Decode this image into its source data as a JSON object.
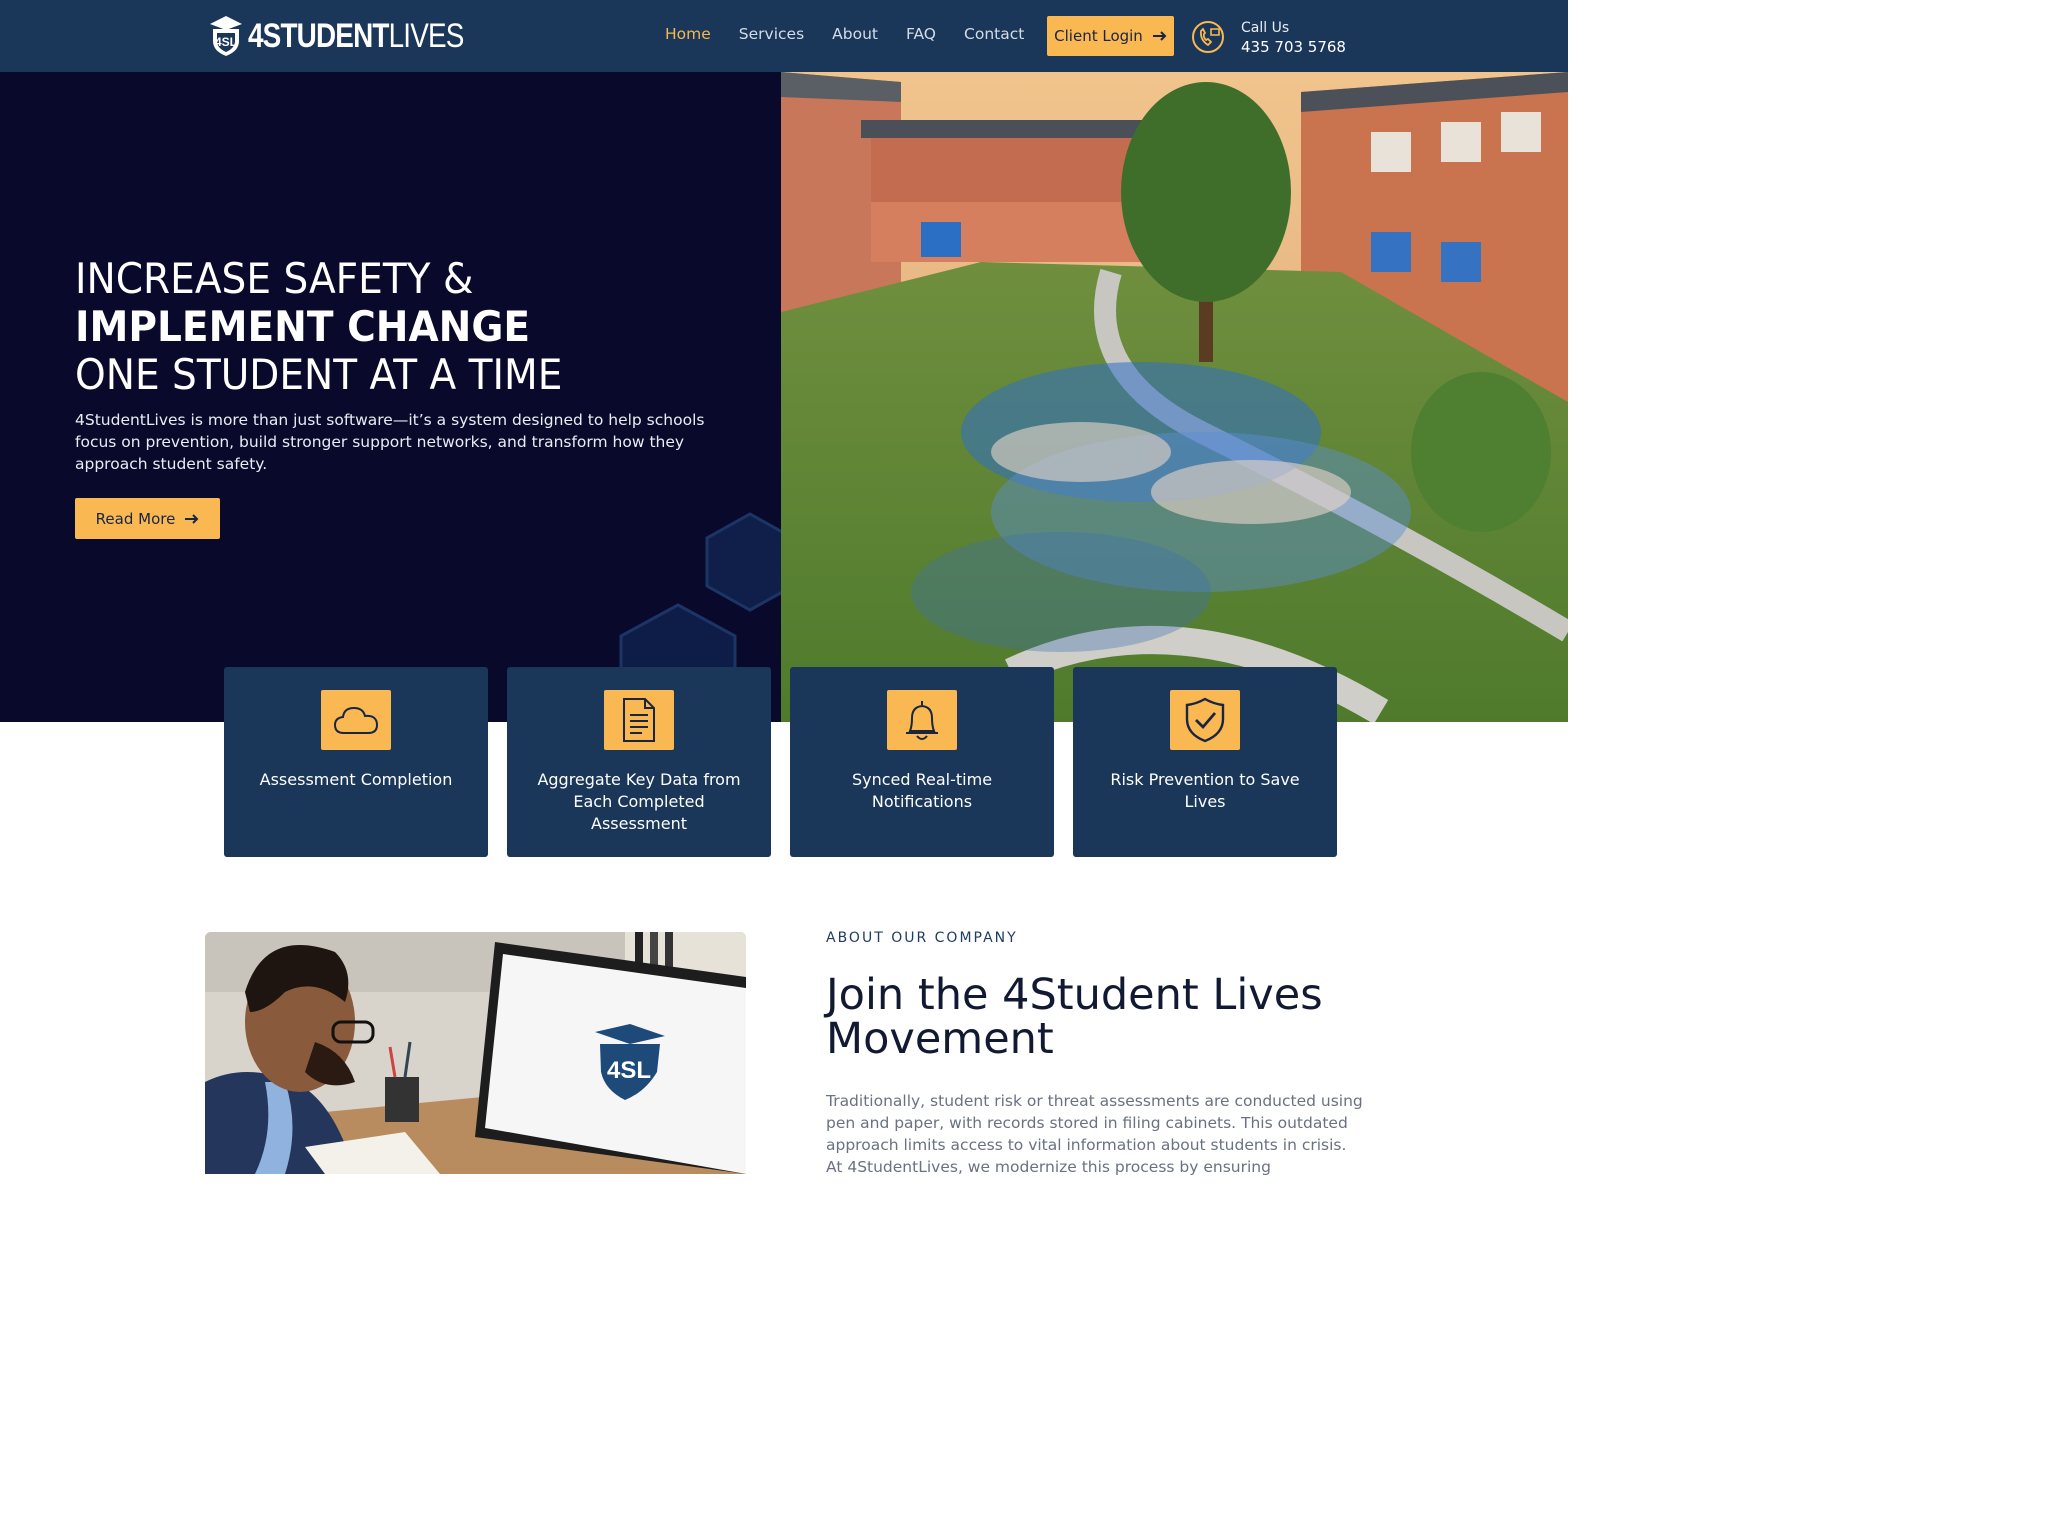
{
  "header": {
    "logo_bold": "4STUDENT",
    "logo_thin": "LIVES",
    "nav": [
      {
        "label": "Home",
        "active": true
      },
      {
        "label": "Services",
        "active": false
      },
      {
        "label": "About",
        "active": false
      },
      {
        "label": "FAQ",
        "active": false
      },
      {
        "label": "Contact",
        "active": false
      }
    ],
    "login_label": "Client Login",
    "call_label": "Call Us",
    "phone": "435 703 5768"
  },
  "hero": {
    "line1": "INCREASE SAFETY &",
    "line2": "IMPLEMENT CHANGE",
    "line3": "ONE STUDENT AT A TIME",
    "subtitle": "4StudentLives is more than just software—it’s a system designed to help schools focus on prevention, build stronger support networks, and transform how they approach student safety.",
    "cta_label": "Read More"
  },
  "features": [
    {
      "icon": "cloud-icon",
      "label": "Assessment Completion"
    },
    {
      "icon": "document-icon",
      "label": "Aggregate Key Data from Each Completed Assessment"
    },
    {
      "icon": "bell-icon",
      "label": "Synced Real-time Notifications"
    },
    {
      "icon": "shield-check-icon",
      "label": "Risk Prevention to Save Lives"
    }
  ],
  "about": {
    "kicker": "ABOUT OUR COMPANY",
    "title": "Join the 4Student Lives Movement",
    "body": "Traditionally, student risk or threat assessments are conducted using pen and paper, with records stored in filing cabinets. This outdated approach limits access to vital information about students in crisis. At 4StudentLives, we modernize this process by ensuring"
  },
  "colors": {
    "header_bg": "#1a3658",
    "hero_bg": "#090a2b",
    "accent": "#f9b852",
    "active_nav": "#f4b850"
  }
}
